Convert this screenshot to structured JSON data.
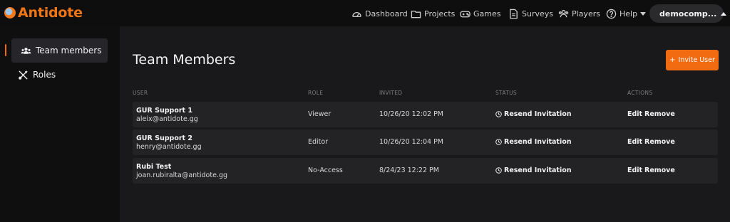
{
  "app": {
    "name": "Antidote"
  },
  "nav": {
    "dashboard": "Dashboard",
    "projects": "Projects",
    "games": "Games",
    "surveys": "Surveys",
    "players": "Players",
    "help": "Help"
  },
  "account": {
    "name": "democomp..."
  },
  "sidebar": {
    "items": [
      {
        "label": "Team members",
        "icon": "users-icon",
        "active": true
      },
      {
        "label": "Roles",
        "icon": "tools-icon",
        "active": false
      }
    ]
  },
  "main": {
    "title": "Team Members",
    "invite_label": "Invite User",
    "invite_plus": "+",
    "columns": [
      "USER",
      "ROLE",
      "INVITED",
      "STATUS",
      "ACTIONS"
    ],
    "rows": [
      {
        "name": "GUR Support 1",
        "email": "aleix@antidote.gg",
        "role": "Viewer",
        "invited": "10/26/20 12:02 PM",
        "status": "Resend Invitation",
        "edit": "Edit",
        "remove": "Remove"
      },
      {
        "name": "GUR Support 2",
        "email": "henry@antidote.gg",
        "role": "Editor",
        "invited": "10/26/20 12:04 PM",
        "status": "Resend Invitation",
        "edit": "Edit",
        "remove": "Remove"
      },
      {
        "name": "Rubi Test",
        "email": "joan.rubiralta@antidote.gg",
        "role": "No-Access",
        "invited": "8/24/23 12:22 PM",
        "status": "Resend Invitation",
        "edit": "Edit",
        "remove": "Remove"
      }
    ]
  },
  "colors": {
    "accent": "#f26b10",
    "background": "#19191b",
    "sidebar": "#0f0f10",
    "row": "#232326"
  }
}
